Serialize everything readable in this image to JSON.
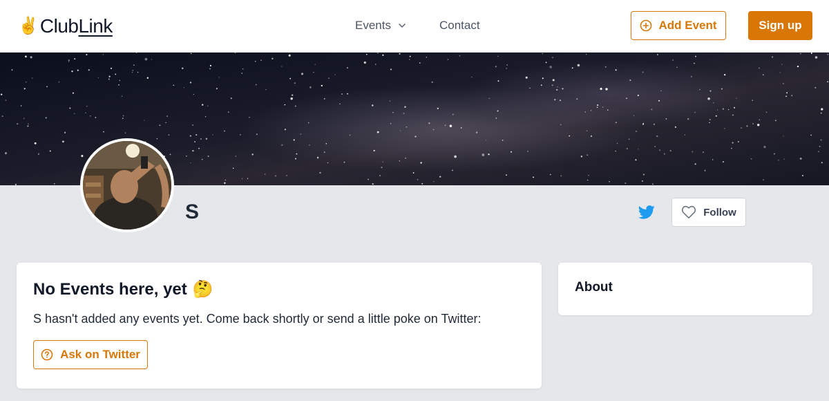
{
  "header": {
    "logo": {
      "hand": "✌️",
      "text_a": "Club",
      "text_b": "Link"
    },
    "nav": [
      {
        "label": "Events",
        "has_dropdown": true
      },
      {
        "label": "Contact",
        "has_dropdown": false
      }
    ],
    "add_event_label": "Add Event",
    "signup_label": "Sign up"
  },
  "profile": {
    "name": "S",
    "follow_label": "Follow"
  },
  "events_card": {
    "title": "No Events here, yet",
    "title_emoji": "🤔",
    "message": "S hasn't added any events yet. Come back shortly or send a little poke on Twitter:",
    "ask_label": "Ask on Twitter"
  },
  "about_card": {
    "title": "About"
  },
  "colors": {
    "accent": "#d97706",
    "twitter": "#1d9bf0",
    "page_bg": "#e5e7eb"
  }
}
